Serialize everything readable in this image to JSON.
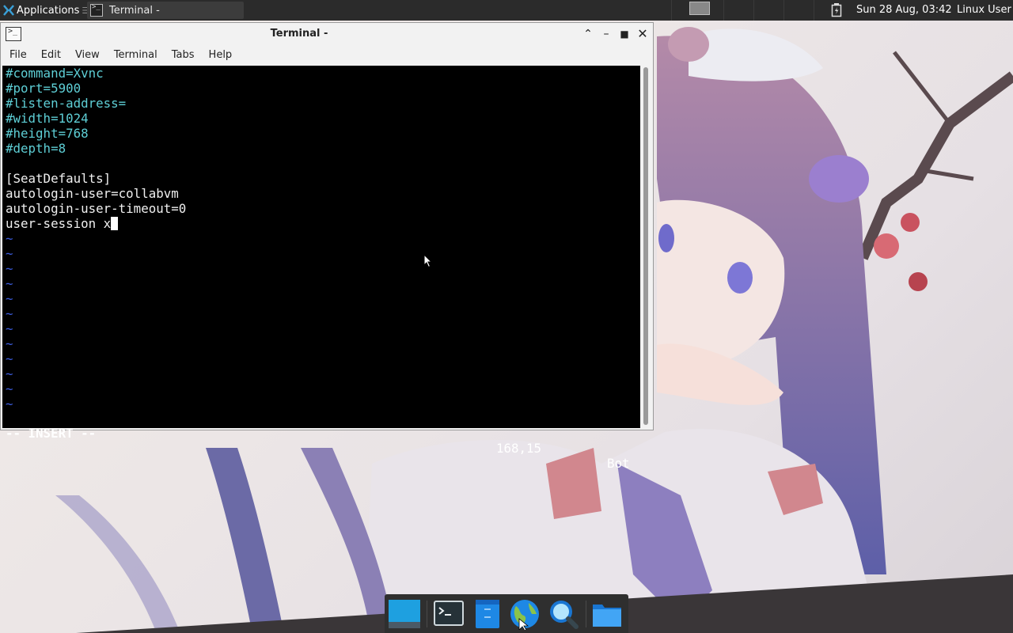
{
  "top_panel": {
    "applications_label": "Applications",
    "applications_sep": "☰",
    "task_label": "Terminal -",
    "clock": "Sun 28 Aug, 03:42",
    "user": "Linux User"
  },
  "window": {
    "title": "Terminal -",
    "menus": [
      "File",
      "Edit",
      "View",
      "Terminal",
      "Tabs",
      "Help"
    ]
  },
  "editor": {
    "lines": [
      {
        "text": "#command=Xvnc",
        "style": "cyan"
      },
      {
        "text": "#port=5900",
        "style": "cyan"
      },
      {
        "text": "#listen-address=",
        "style": "cyan"
      },
      {
        "text": "#width=1024",
        "style": "cyan"
      },
      {
        "text": "#height=768",
        "style": "cyan"
      },
      {
        "text": "#depth=8",
        "style": "cyan"
      },
      {
        "text": "",
        "style": "white"
      },
      {
        "text": "[SeatDefaults]",
        "style": "white"
      },
      {
        "text": "autologin-user=collabvm",
        "style": "white"
      },
      {
        "text": "autologin-user-timeout=0",
        "style": "white"
      },
      {
        "text": "user-session x",
        "style": "white",
        "cursor": true
      },
      {
        "text": "~",
        "style": "tilde"
      },
      {
        "text": "~",
        "style": "tilde"
      },
      {
        "text": "~",
        "style": "tilde"
      },
      {
        "text": "~",
        "style": "tilde"
      },
      {
        "text": "~",
        "style": "tilde"
      },
      {
        "text": "~",
        "style": "tilde"
      },
      {
        "text": "~",
        "style": "tilde"
      },
      {
        "text": "~",
        "style": "tilde"
      },
      {
        "text": "~",
        "style": "tilde"
      },
      {
        "text": "~",
        "style": "tilde"
      },
      {
        "text": "~",
        "style": "tilde"
      },
      {
        "text": "~",
        "style": "tilde"
      }
    ],
    "mode": "-- INSERT --",
    "position": "168,15",
    "scroll": "Bot"
  },
  "colors": {
    "comment": "#5ecfd6",
    "tilde": "#3b5bdb",
    "panel": "#2b2b2b"
  },
  "dock": {
    "items": [
      "show-desktop",
      "terminal",
      "text-editor",
      "web-browser",
      "app-finder",
      "file-manager"
    ]
  }
}
